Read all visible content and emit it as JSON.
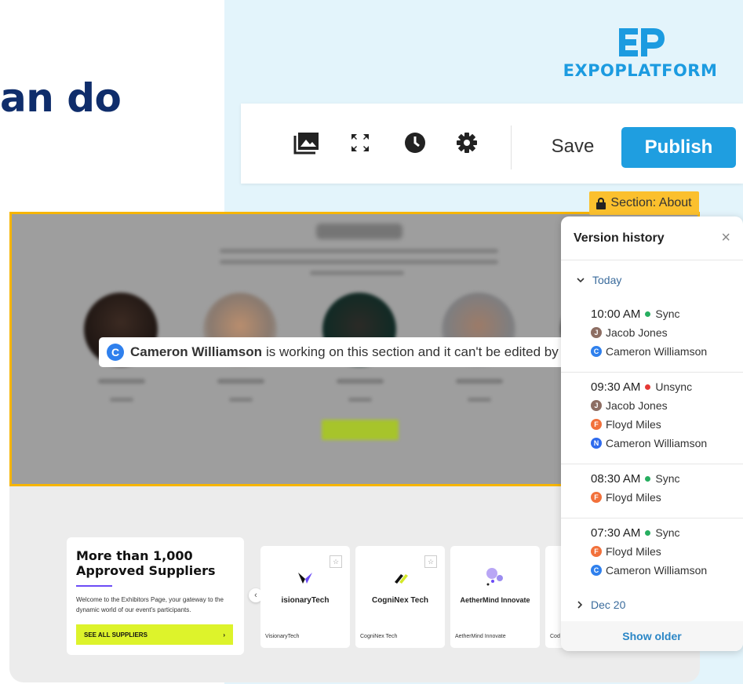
{
  "hero": {
    "text": "an do"
  },
  "logo": {
    "text": "EXPOPLATFORM",
    "color": "#1c9be0"
  },
  "toolbar": {
    "icons": [
      "image-gallery-icon",
      "fullscreen-icon",
      "clock-icon",
      "gear-icon"
    ],
    "save_label": "Save",
    "publish_label": "Publish",
    "accent": "#1f9ee0"
  },
  "section_tag": {
    "label": "Section: About"
  },
  "lock_banner": {
    "initial": "C",
    "user": "Cameron Williamson",
    "message": "is working on this section and it can't be edited by anyo"
  },
  "suppliers": {
    "title_line1": "More than 1,000",
    "title_line2": "Approved Suppliers",
    "description": "Welcome to the Exhibitors Page, your gateway to the dynamic world of our event's participants.",
    "button_label": "SEE ALL SUPPLIERS",
    "button_arrow": "›"
  },
  "exhibitors": [
    {
      "brand": "isionaryTech",
      "name": "VisionaryTech"
    },
    {
      "brand": "CogniNex Tech",
      "name": "CogniNex Tech"
    },
    {
      "brand": "AetherMind Innovate",
      "name": "AetherMind Innovate"
    },
    {
      "brand": "",
      "name": "Cod"
    }
  ],
  "version_history": {
    "title": "Version history",
    "close": "×",
    "today_label": "Today",
    "entries": [
      {
        "time": "10:00 AM",
        "status": "Sync",
        "status_color": "#27ae60",
        "users": [
          {
            "initial": "J",
            "name": "Jacob Jones",
            "color": "#8d6e63"
          },
          {
            "initial": "C",
            "name": "Cameron Williamson",
            "color": "#2f80ed"
          }
        ]
      },
      {
        "time": "09:30 AM",
        "status": "Unsync",
        "status_color": "#e53935",
        "users": [
          {
            "initial": "J",
            "name": "Jacob Jones",
            "color": "#8d6e63"
          },
          {
            "initial": "F",
            "name": "Floyd Miles",
            "color": "#f2713b"
          },
          {
            "initial": "N",
            "name": "Cameron Williamson",
            "color": "#2f6bed"
          }
        ]
      },
      {
        "time": "08:30 AM",
        "status": "Sync",
        "status_color": "#27ae60",
        "users": [
          {
            "initial": "F",
            "name": "Floyd Miles",
            "color": "#f2713b"
          }
        ]
      },
      {
        "time": "07:30 AM",
        "status": "Sync",
        "status_color": "#27ae60",
        "users": [
          {
            "initial": "F",
            "name": "Floyd Miles",
            "color": "#f2713b"
          },
          {
            "initial": "C",
            "name": "Cameron Williamson",
            "color": "#2f80ed"
          }
        ]
      }
    ],
    "older_group_label": "Dec 20",
    "show_older_label": "Show older"
  }
}
